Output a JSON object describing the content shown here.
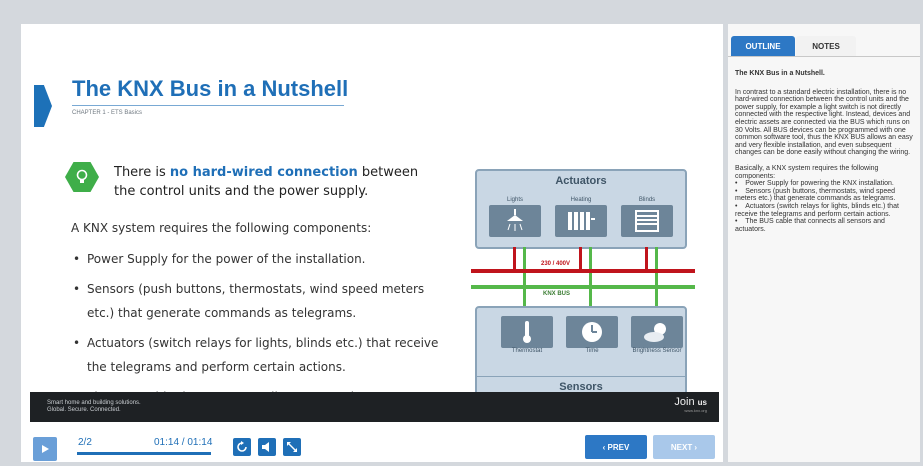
{
  "slide": {
    "title": "The KNX Bus in a Nutshell",
    "chapter": "CHAPTER 1 - ETS Basics",
    "tip_before": "There is ",
    "tip_highlight": "no hard-wired connection",
    "tip_after": " between the control units and the power supply.",
    "intro": "A KNX system requires the following components:",
    "bullets": [
      "Power Supply for the power of the installation.",
      "Sensors (push buttons, thermostats, wind speed meters etc.) that generate commands as telegrams.",
      "Actuators (switch relays for lights, blinds etc.) that receive the telegrams and perform certain actions.",
      "The BUS cable that connects all sensors and actuators."
    ]
  },
  "diagram": {
    "actuators_title": "Actuators",
    "actuators": [
      "Lights",
      "Heating",
      "Blinds"
    ],
    "power_label": "230 / 400V",
    "bus_label": "KNX BUS",
    "sensors_title": "Sensors",
    "sensors": [
      "Thermostat",
      "Time",
      "Brightness Sensor"
    ],
    "colors": {
      "power_line": "#c0141c",
      "bus_line": "#55b84a",
      "box_fill": "#c9d7e4",
      "tile": "#6d8599"
    }
  },
  "footer": {
    "tagline_1": "Smart home and building solutions.",
    "tagline_2": "Global. Secure. Connected.",
    "join": "Join",
    "join_us": "us",
    "join_sub": "www.knx.org"
  },
  "controls": {
    "page": "2/2",
    "time": "01:14 / 01:14",
    "progress_fraction": 1.0,
    "prev_label": "‹  PREV",
    "next_label": "NEXT  ›"
  },
  "side_panel": {
    "tabs": [
      "OUTLINE",
      "NOTES"
    ],
    "active_tab": "NOTES",
    "notes_title": "The KNX Bus in a Nutshell.",
    "notes_p1": "In contrast to a standard electric installation, there is no hard-wired connection between the control units and the power supply, for example a light switch is not directly connected with the respective light. Instead, devices and electric assets are connected via the BUS which runs on 30 Volts. All BUS devices can be programmed with one common software tool, thus the KNX BUS allows an easy and very flexible installation, and even subsequent changes can be done easily without changing the wiring.",
    "notes_p2": "Basically, a KNX system requires the following components:",
    "notes_items": [
      "Power Supply for powering the KNX installation.",
      "Sensors (push buttons, thermostats, wind speed meters etc.) that generate commands as telegrams.",
      "Actuators (switch relays for lights, blinds etc.) that receive the telegrams and perform certain actions.",
      "The BUS cable that connects all sensors and actuators."
    ]
  },
  "theme": {
    "accent": "#1f6fb7",
    "tip_green": "#3fae49"
  }
}
